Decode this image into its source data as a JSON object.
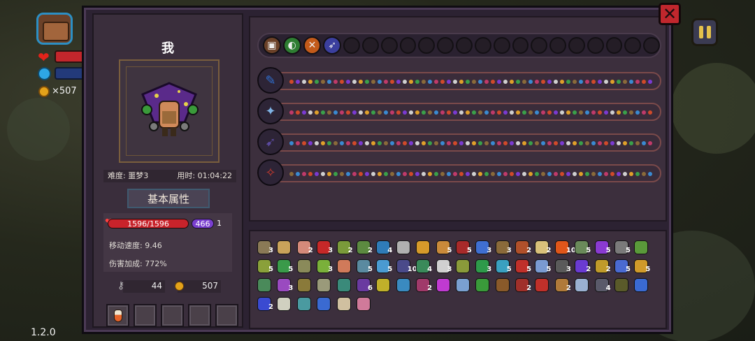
{
  "hud": {
    "coins": "×507",
    "version": "1.2.0"
  },
  "panel": {
    "player_name": "我",
    "difficulty": "难度: 噩梦3",
    "time": "用时: 01:04:22",
    "basic_attr_label": "基本属性",
    "hp": "1596/1596",
    "shield": "466",
    "shield_count": "1",
    "move_speed": "移动速度: 9.46",
    "damage_bonus": "伤害加成: 772%",
    "keys": "44",
    "gold": "507"
  },
  "weapon_icons": [
    {
      "name": "chest-icon",
      "color": "#6b4128",
      "glyph": "▣"
    },
    {
      "name": "bow-icon",
      "color": "#2e7d32",
      "glyph": "◐"
    },
    {
      "name": "crossbow-icon",
      "color": "#c25a1a",
      "glyph": "✕"
    },
    {
      "name": "arrow-icon",
      "color": "#3b3f9e",
      "glyph": "➶"
    }
  ],
  "staffs": [
    {
      "name": "ice-staff",
      "color": "#2f6fd1",
      "glyph": "✎"
    },
    {
      "name": "crystal-staff",
      "color": "#7fb3e6",
      "glyph": "✦"
    },
    {
      "name": "spear-staff",
      "color": "#5b4aa0",
      "glyph": "➹"
    },
    {
      "name": "fire-staff",
      "color": "#c73a2e",
      "glyph": "✧"
    }
  ],
  "items": [
    {
      "n": "3",
      "c": "#8a7a56"
    },
    {
      "n": "",
      "c": "#c9a35a"
    },
    {
      "n": "2",
      "c": "#d58a7a"
    },
    {
      "n": "3",
      "c": "#c62828"
    },
    {
      "n": "2",
      "c": "#7a9a3a"
    },
    {
      "n": "2",
      "c": "#5c8a40"
    },
    {
      "n": "4",
      "c": "#2f7cb8"
    },
    {
      "n": "",
      "c": "#b0b0b0"
    },
    {
      "n": "",
      "c": "#d69a2a"
    },
    {
      "n": "5",
      "c": "#c98a3a"
    },
    {
      "n": "5",
      "c": "#a82a2a"
    },
    {
      "n": "3",
      "c": "#3f6fd1"
    },
    {
      "n": "3",
      "c": "#8a6a3a"
    },
    {
      "n": "2",
      "c": "#b0502a"
    },
    {
      "n": "2",
      "c": "#d8c07a"
    },
    {
      "n": "10",
      "c": "#e0561a"
    },
    {
      "n": "5",
      "c": "#6a8a5a"
    },
    {
      "n": "5",
      "c": "#8a3ad1"
    },
    {
      "n": "5",
      "c": "#7a7a7a"
    },
    {
      "n": "",
      "c": "#5a9a3a"
    },
    {
      "n": "5",
      "c": "#8aa03a"
    },
    {
      "n": "5",
      "c": "#3a9a4a"
    },
    {
      "n": "",
      "c": "#8a8a5a"
    },
    {
      "n": "3",
      "c": "#7ab03a"
    },
    {
      "n": "",
      "c": "#d07a5a"
    },
    {
      "n": "5",
      "c": "#5a8aa0"
    },
    {
      "n": "5",
      "c": "#4a9ad1"
    },
    {
      "n": "10",
      "c": "#4a4a8a"
    },
    {
      "n": "4",
      "c": "#3a8a5a"
    },
    {
      "n": "3",
      "c": "#d0d0d0"
    },
    {
      "n": "",
      "c": "#8a9a3a"
    },
    {
      "n": "3",
      "c": "#2e9a4a"
    },
    {
      "n": "5",
      "c": "#3aa0c0"
    },
    {
      "n": "5",
      "c": "#c0302a"
    },
    {
      "n": "5",
      "c": "#7a9ad1"
    },
    {
      "n": "3",
      "c": "#5a5a5a"
    },
    {
      "n": "2",
      "c": "#6a3ad1"
    },
    {
      "n": "2",
      "c": "#c09a2a"
    },
    {
      "n": "5",
      "c": "#4a6ad1"
    },
    {
      "n": "5",
      "c": "#d09a2a"
    },
    {
      "n": "",
      "c": "#4a8a5a"
    },
    {
      "n": "3",
      "c": "#9a4ac0"
    },
    {
      "n": "",
      "c": "#8a7a3a"
    },
    {
      "n": "",
      "c": "#9a9a7a"
    },
    {
      "n": "",
      "c": "#3a8a7a"
    },
    {
      "n": "6",
      "c": "#6a3aa0"
    },
    {
      "n": "",
      "c": "#c0b02a"
    },
    {
      "n": "",
      "c": "#3a8ac0"
    },
    {
      "n": "2",
      "c": "#a03a6a"
    },
    {
      "n": "",
      "c": "#c03ad1"
    },
    {
      "n": "",
      "c": "#7aa0d1"
    },
    {
      "n": "",
      "c": "#3a9a3a"
    },
    {
      "n": "",
      "c": "#8a5a2a"
    },
    {
      "n": "2",
      "c": "#a0302a"
    },
    {
      "n": "",
      "c": "#c0302a"
    },
    {
      "n": "2",
      "c": "#b07a3a"
    },
    {
      "n": "",
      "c": "#9ab0d1"
    },
    {
      "n": "4",
      "c": "#5a5a6a"
    },
    {
      "n": "",
      "c": "#5a5a2a"
    },
    {
      "n": "",
      "c": "#3a6ad1"
    },
    {
      "n": "2",
      "c": "#3a4ad1"
    },
    {
      "n": "",
      "c": "#d0d0c0"
    },
    {
      "n": "",
      "c": "#4a9aa0"
    },
    {
      "n": "",
      "c": "#3a6ad1"
    },
    {
      "n": "",
      "c": "#d0c0a0"
    },
    {
      "n": "",
      "c": "#d07a9a"
    }
  ]
}
